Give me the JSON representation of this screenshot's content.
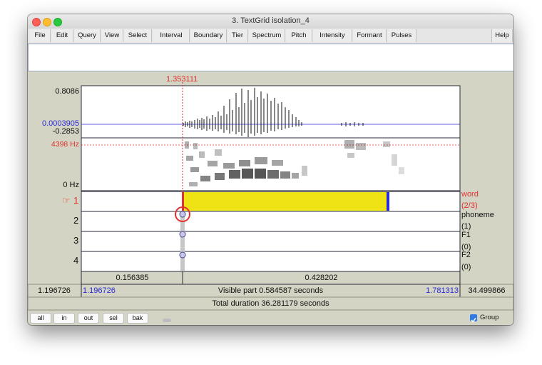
{
  "window": {
    "title": "3. TextGrid isolation_4"
  },
  "menu": {
    "file": "File",
    "edit": "Edit",
    "query": "Query",
    "view": "View",
    "select": "Select",
    "interval": "Interval",
    "boundary": "Boundary",
    "tier": "Tier",
    "spectrum": "Spectrum",
    "pitch": "Pitch",
    "intensity": "Intensity",
    "formant": "Formant",
    "pulses": "Pulses",
    "help": "Help"
  },
  "cursor": {
    "time": "1.353111"
  },
  "waveform": {
    "max": "0.8086",
    "center": "0.0003905",
    "min": "-0.2853"
  },
  "spectrogram": {
    "cursor_freq": "4398 Hz",
    "bottom": "0 Hz"
  },
  "tiers": [
    {
      "number": "1",
      "pointer": "☞",
      "name": "word",
      "count": "(2/3)"
    },
    {
      "number": "2",
      "name": "phoneme",
      "count": "(1)"
    },
    {
      "number": "3",
      "name": "F1",
      "count": "(0)"
    },
    {
      "number": "4",
      "name": "F2",
      "count": "(0)"
    }
  ],
  "segments": {
    "left": "0.156385",
    "right": "0.428202"
  },
  "visible_row": {
    "start_total": "1.196726",
    "start_visible": "1.196726",
    "label": "Visible part 0.584587 seconds",
    "end_visible": "1.781313",
    "end_total": "34.499866"
  },
  "total": {
    "label": "Total duration 36.281179 seconds"
  },
  "buttons": {
    "all": "all",
    "in": "in",
    "out": "out",
    "sel": "sel",
    "bak": "bak"
  },
  "group": {
    "label": "Group",
    "checked": true
  },
  "colors": {
    "accent_red": "#e03030",
    "accent_blue": "#2a2ad8",
    "interval_yellow": "#eee315",
    "panel_bg": "#d4d4c4"
  }
}
